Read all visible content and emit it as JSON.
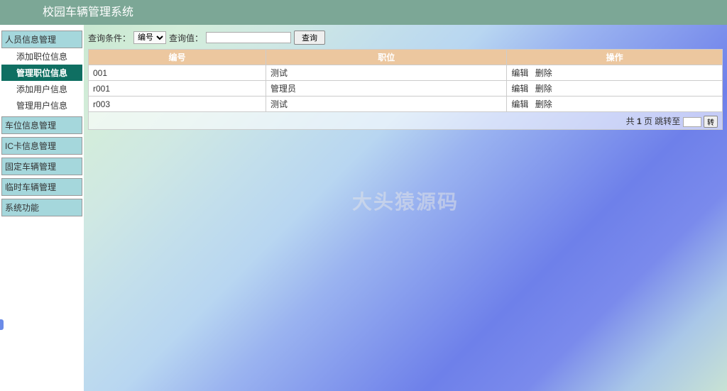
{
  "header": {
    "title": "校园车辆管理系统"
  },
  "sidebar": {
    "groups": [
      {
        "label": "人员信息管理",
        "items": [
          {
            "label": "添加职位信息",
            "active": false
          },
          {
            "label": "管理职位信息",
            "active": true
          },
          {
            "label": "添加用户信息",
            "active": false
          },
          {
            "label": "管理用户信息",
            "active": false
          }
        ]
      },
      {
        "label": "车位信息管理",
        "items": []
      },
      {
        "label": "IC卡信息管理",
        "items": []
      },
      {
        "label": "固定车辆管理",
        "items": []
      },
      {
        "label": "临时车辆管理",
        "items": []
      },
      {
        "label": "系统功能",
        "items": []
      }
    ]
  },
  "search": {
    "condition_label": "查询条件：",
    "select_value": "编号",
    "value_label": "查询值：",
    "input_value": "",
    "button_label": "查询"
  },
  "table": {
    "headers": [
      "编号",
      "职位",
      "操作"
    ],
    "rows": [
      {
        "id": "001",
        "role": "测试"
      },
      {
        "id": "r001",
        "role": "管理员"
      },
      {
        "id": "r003",
        "role": "测试"
      }
    ],
    "actions": {
      "edit": "编辑",
      "delete": "删除"
    }
  },
  "pagination": {
    "prefix": "共",
    "total": "1",
    "suffix": "页 跳转至",
    "go": "转"
  },
  "watermark": "大头猿源码"
}
